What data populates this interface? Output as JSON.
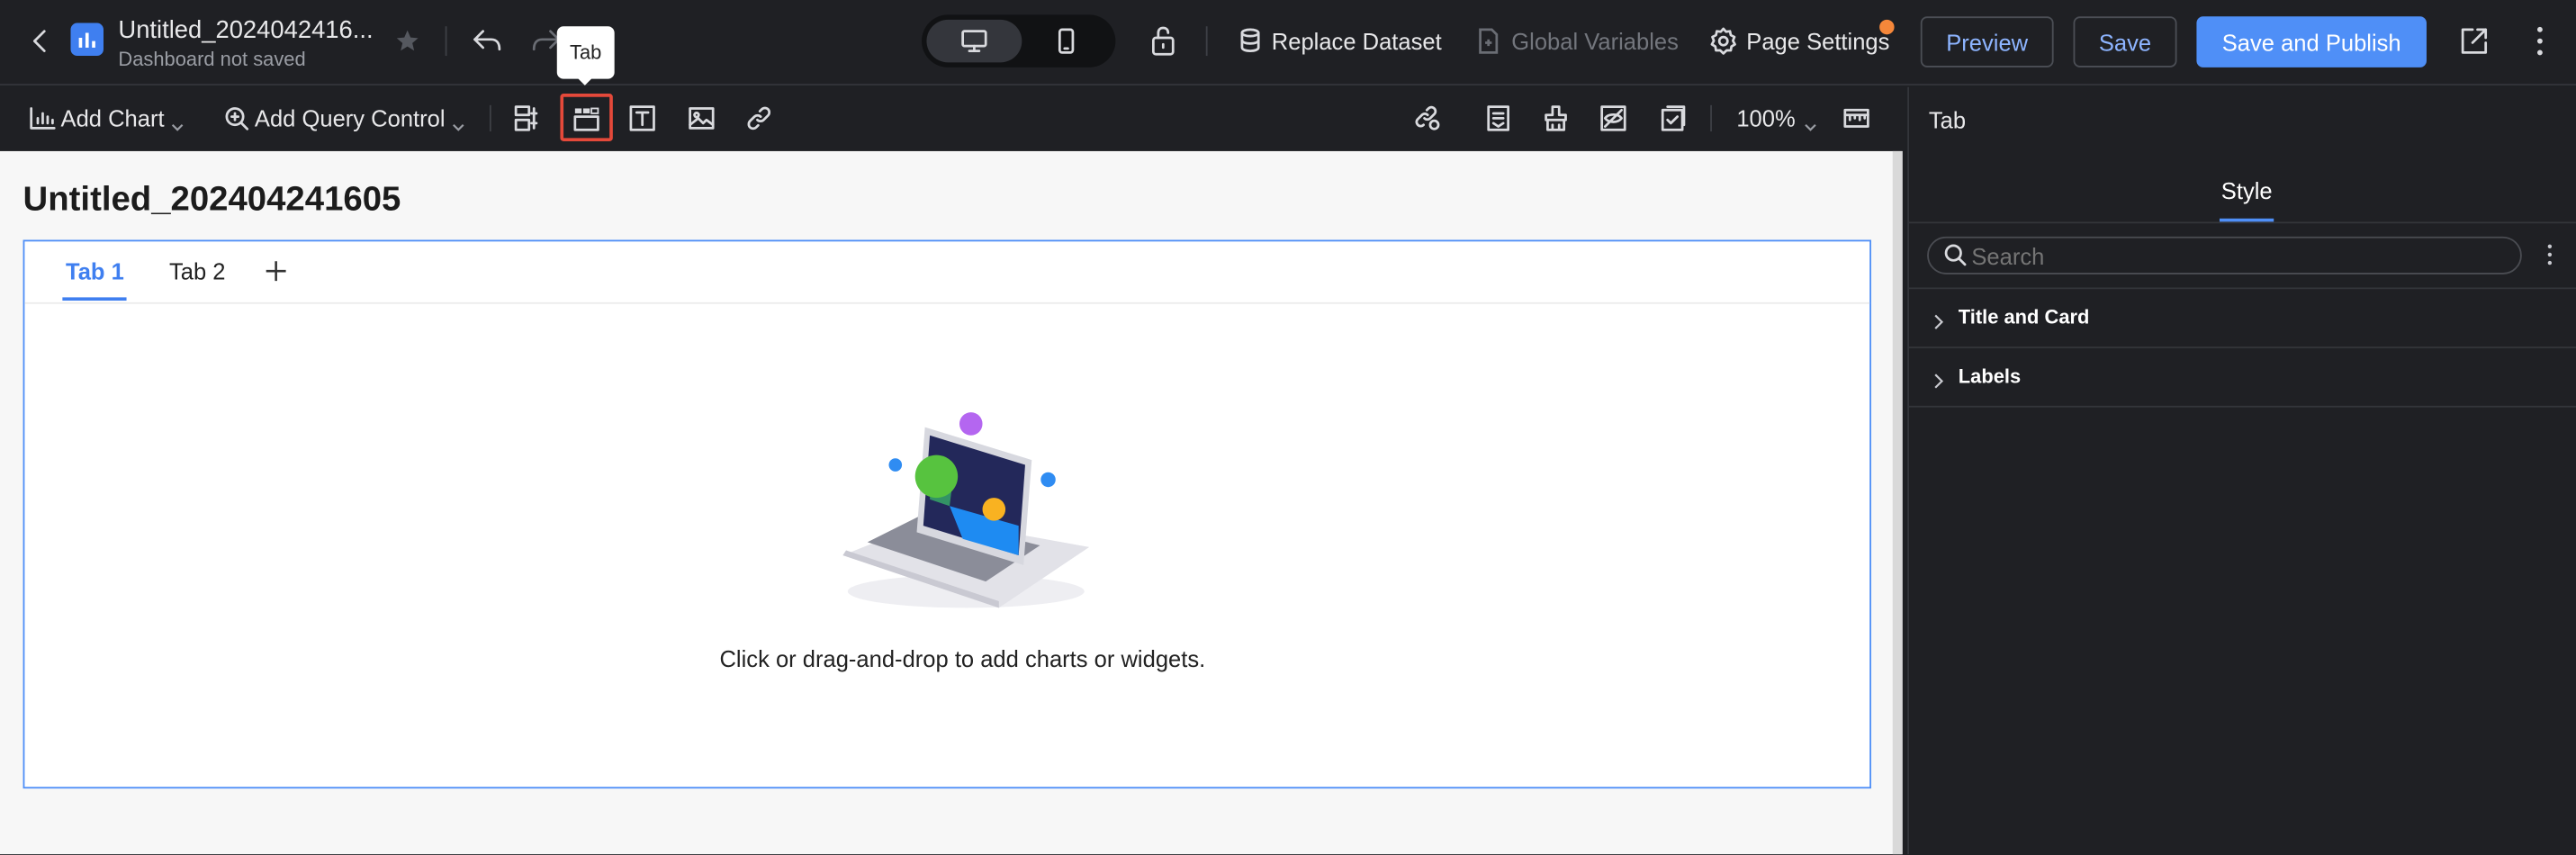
{
  "header": {
    "dashboard_title": "Untitled_2024042416...",
    "save_status": "Dashboard not saved",
    "replace_dataset": "Replace Dataset",
    "global_variables": "Global Variables",
    "page_settings": "Page Settings",
    "preview": "Preview",
    "save": "Save",
    "save_and_publish": "Save and Publish"
  },
  "tooltip": {
    "text": "Tab"
  },
  "toolbar": {
    "add_chart": "Add Chart",
    "add_query_control": "Add Query Control",
    "zoom": "100%"
  },
  "canvas": {
    "page_title": "Untitled_202404241605",
    "tabs": [
      {
        "label": "Tab 1",
        "active": true
      },
      {
        "label": "Tab 2",
        "active": false
      }
    ],
    "empty_message": "Click or drag-and-drop to add charts or widgets."
  },
  "right_panel": {
    "title": "Tab",
    "active_tab": "Style",
    "search_placeholder": "Search",
    "sections": [
      {
        "label": "Title and Card"
      },
      {
        "label": "Labels"
      }
    ]
  },
  "colors": {
    "accent": "#4f8ff7",
    "tab_active": "#3f7ff0",
    "highlight_box": "#e5493a",
    "badge": "#f5873a",
    "dark_bg": "#1f2024",
    "canvas_bg": "#f7f7f7"
  }
}
